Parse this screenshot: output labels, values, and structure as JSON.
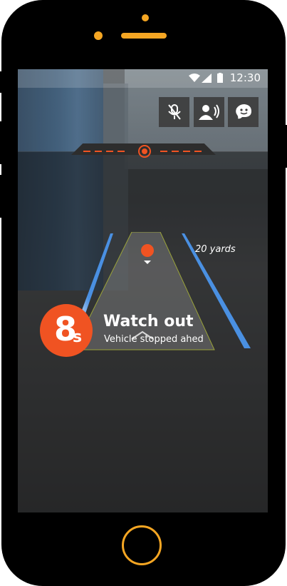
{
  "status_bar": {
    "time": "12:30"
  },
  "controls": [
    {
      "name": "mute-button",
      "icon": "mic-off-icon"
    },
    {
      "name": "voice-button",
      "icon": "voice-icon"
    },
    {
      "name": "waze-button",
      "icon": "waze-icon"
    }
  ],
  "road": {
    "distance_label": "20 yards"
  },
  "alert": {
    "countdown": "8",
    "unit": "s",
    "title": "Watch out",
    "subtitle": "Vehicle stopped ahed"
  },
  "colors": {
    "accent": "#f05322",
    "lane": "#4a90e2",
    "home_ring": "#f5a623"
  }
}
